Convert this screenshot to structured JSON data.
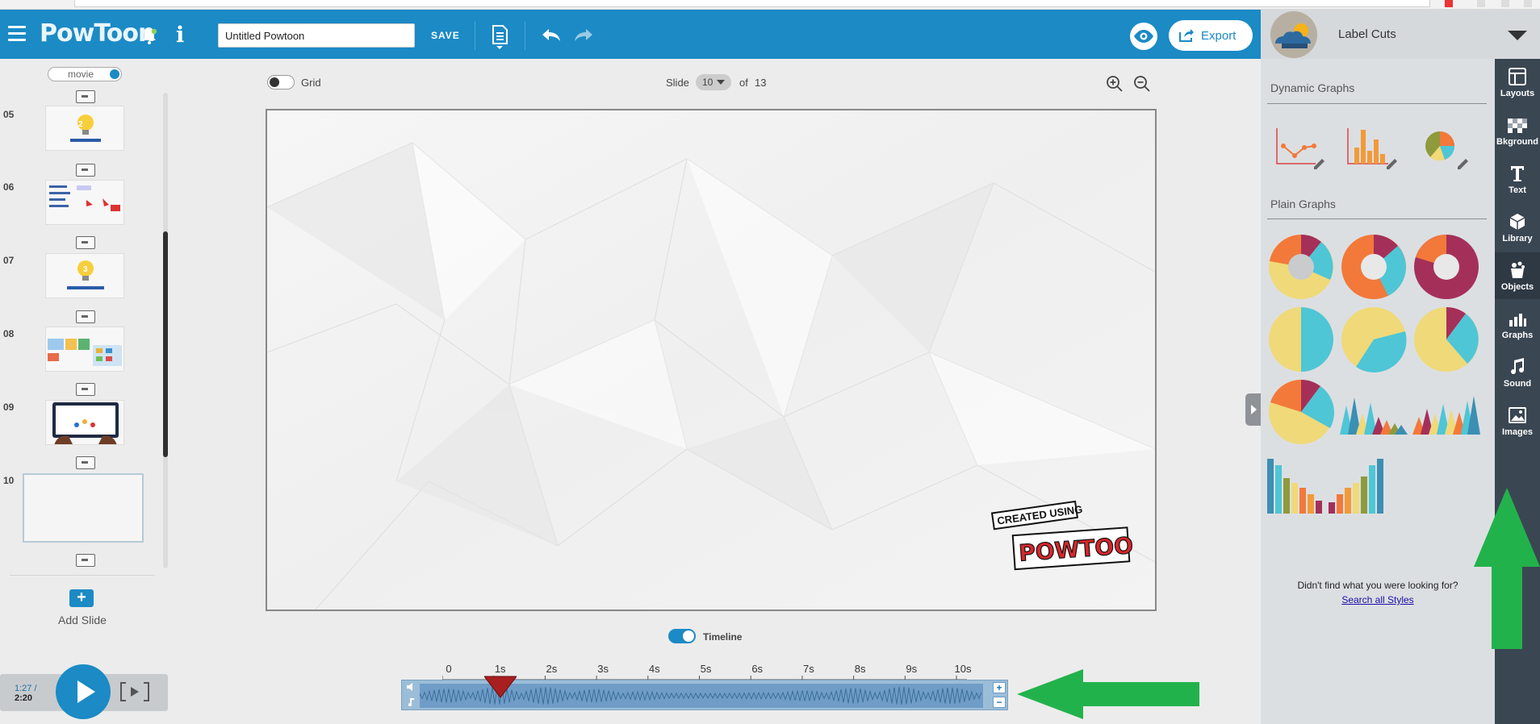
{
  "header": {
    "logo_text": "PowToon",
    "title_value": "Untitled Powtoon",
    "save_label": "SAVE",
    "info_label": "i",
    "export_label": "Export"
  },
  "user": {
    "name": "Label Cuts"
  },
  "left_panel": {
    "mode_label": "movie",
    "slides": [
      {
        "number": "05",
        "selected": false
      },
      {
        "number": "06",
        "selected": false
      },
      {
        "number": "07",
        "selected": false
      },
      {
        "number": "08",
        "selected": false
      },
      {
        "number": "09",
        "selected": false
      },
      {
        "number": "10",
        "selected": true
      }
    ],
    "add_slide_icon": "+",
    "add_slide_label": "Add Slide"
  },
  "playback": {
    "current_time": "1:27 /",
    "total_time": "2:20"
  },
  "canvas": {
    "grid_label": "Grid",
    "grid_on": false,
    "slide_label": "Slide",
    "current_slide": "10",
    "of_label": "of",
    "total_slides": "13",
    "watermark_top": "CREATED USING",
    "watermark_brand": "POWTOON"
  },
  "timeline": {
    "label": "Timeline",
    "enabled": true,
    "ticks": [
      "0",
      "1s",
      "2s",
      "3s",
      "4s",
      "5s",
      "6s",
      "7s",
      "8s",
      "9s",
      "10s"
    ],
    "playhead_seconds": 1,
    "plus": "+",
    "minus": "−"
  },
  "right_panel": {
    "dynamic_title": "Dynamic Graphs",
    "plain_title": "Plain Graphs",
    "help_text": "Didn't find what you were looking for?",
    "help_link": "Search all Styles"
  },
  "side_nav": [
    {
      "label": "Layouts",
      "icon": "layouts-icon"
    },
    {
      "label": "Bkground",
      "icon": "checker-icon"
    },
    {
      "label": "Text",
      "icon": "text-icon"
    },
    {
      "label": "Library",
      "icon": "cube-icon"
    },
    {
      "label": "Objects",
      "icon": "objects-icon"
    },
    {
      "label": "Graphs",
      "icon": "bar-chart-icon"
    },
    {
      "label": "Sound",
      "icon": "music-note-icon"
    },
    {
      "label": "Images",
      "icon": "image-icon"
    }
  ],
  "colors": {
    "brand_blue": "#1b8ac5",
    "nav_dark": "#3a4652",
    "annotation_green": "#22b24c",
    "graph_orange": "#f2793a",
    "graph_cyan": "#4ec6d6",
    "graph_yellow": "#f0d979",
    "graph_maroon": "#a4305a"
  }
}
